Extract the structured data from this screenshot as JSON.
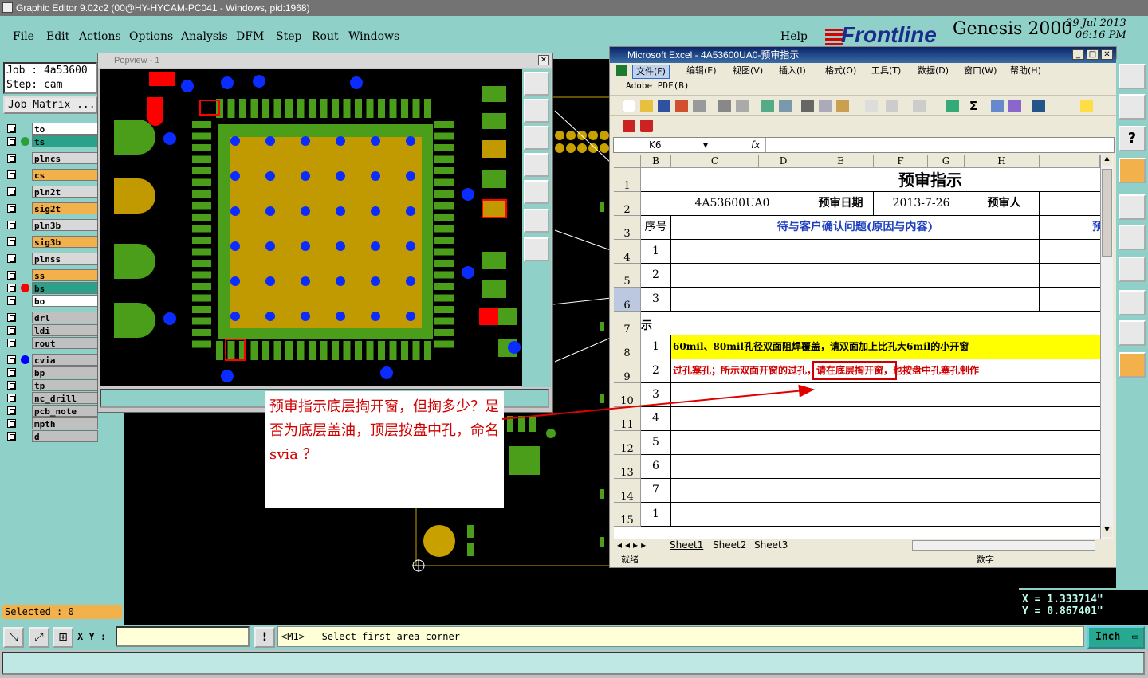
{
  "app": {
    "title": "Graphic Editor 9.02c2 (00@HY-HYCAM-PC041 - Windows, pid:1968)"
  },
  "menu": {
    "items": [
      "File",
      "Edit",
      "Actions",
      "Options",
      "Analysis",
      "DFM",
      "Step",
      "Rout",
      "Windows"
    ],
    "help": "Help"
  },
  "brand": {
    "logo": "Frontline",
    "product": "Genesis 2000",
    "date": "29 Jul 2013",
    "time": "06:16 PM"
  },
  "job": {
    "job_line": "Job : 4a53600",
    "step_line": "Step: cam",
    "matrix_button": "Job Matrix ..."
  },
  "layers": [
    {
      "name": "to",
      "color": "#ffffff",
      "dot": ""
    },
    {
      "name": "ts",
      "color": "#2aa28a",
      "dot": "#2aa23a"
    },
    {
      "name": "plncs",
      "color": "#d8d8d8",
      "dot": ""
    },
    {
      "name": "cs",
      "color": "#f2b14a",
      "dot": ""
    },
    {
      "name": "pln2t",
      "color": "#d8d8d8",
      "dot": ""
    },
    {
      "name": "sig2t",
      "color": "#f2b14a",
      "dot": ""
    },
    {
      "name": "pln3b",
      "color": "#d8d8d8",
      "dot": ""
    },
    {
      "name": "sig3b",
      "color": "#f2b14a",
      "dot": ""
    },
    {
      "name": "plnss",
      "color": "#d8d8d8",
      "dot": ""
    },
    {
      "name": "ss",
      "color": "#f2b14a",
      "dot": ""
    },
    {
      "name": "bs",
      "color": "#2aa28a",
      "dot": "#ff0000"
    },
    {
      "name": "bo",
      "color": "#ffffff",
      "dot": ""
    },
    {
      "name": "drl",
      "color": "#c0c0c0",
      "dot": ""
    },
    {
      "name": "ldi",
      "color": "#c0c0c0",
      "dot": ""
    },
    {
      "name": "rout",
      "color": "#c0c0c0",
      "dot": ""
    },
    {
      "name": "cvia",
      "color": "#c0c0c0",
      "dot": "#0000ff"
    },
    {
      "name": "bp",
      "color": "#c0c0c0",
      "dot": ""
    },
    {
      "name": "tp",
      "color": "#c0c0c0",
      "dot": ""
    },
    {
      "name": "nc_drill",
      "color": "#c0c0c0",
      "dot": ""
    },
    {
      "name": "pcb_note",
      "color": "#c0c0c0",
      "dot": ""
    },
    {
      "name": "mpth",
      "color": "#c0c0c0",
      "dot": ""
    },
    {
      "name": "d",
      "color": "#c0c0c0",
      "dot": ""
    }
  ],
  "selected": "Selected : 0",
  "popview": {
    "title": "Popview - 1"
  },
  "toolbar_bottom": {
    "xy_label": "X Y :",
    "xy_value": "",
    "prompt": "<M1> - Select first area corner",
    "units": "Inch",
    "warn": "!"
  },
  "coords": {
    "x": "X = 1.333714\"",
    "y": "Y = 0.867401\""
  },
  "excel": {
    "title": "Microsoft Excel - 4A53600UA0-预审指示",
    "menus": [
      "文件(F)",
      "编辑(E)",
      "视图(V)",
      "插入(I)",
      "格式(O)",
      "工具(T)",
      "数据(D)",
      "窗口(W)",
      "帮助(H)"
    ],
    "adobe": "Adobe PDF(B)",
    "cell_ref": "K6",
    "fx": "fx",
    "columns": [
      "B",
      "C",
      "D",
      "E",
      "F",
      "G",
      "H"
    ],
    "rows": [
      "1",
      "2",
      "3",
      "4",
      "5",
      "6",
      "7",
      "8",
      "9",
      "10",
      "11",
      "12",
      "13",
      "14",
      "15"
    ],
    "sheet_title": "预审指示",
    "job_no": "4A53600UA0",
    "date_label": "预审日期",
    "date_value": "2013-7-26",
    "person_label": "预审人",
    "seq_label": "序号",
    "issue_header": "待与客户确认问题(原因与内容)",
    "right_cut": "预",
    "issue_nums": [
      "1",
      "2",
      "3"
    ],
    "section7": "示",
    "items": [
      {
        "n": "1",
        "text": "60mil、80mil孔径双面阻焊覆盖，请双面加上比孔大6mil的小开窗"
      },
      {
        "n": "2",
        "text_a": "过孔塞孔；所示双面开窗的过孔，",
        "text_b": "请在底层掏开窗，",
        "text_c": "也按盘中孔塞孔制作"
      },
      {
        "n": "3"
      },
      {
        "n": "4"
      },
      {
        "n": "5"
      },
      {
        "n": "6"
      },
      {
        "n": "7"
      },
      {
        "n": "1"
      }
    ],
    "sheets": [
      "Sheet1",
      "Sheet2",
      "Sheet3"
    ],
    "status_left": "就绪",
    "status_right": "数字"
  },
  "callout": {
    "text": "预审指示底层掏开窗，但掏多少？是否为底层盖油，顶层按盘中孔，命名svia ？"
  }
}
